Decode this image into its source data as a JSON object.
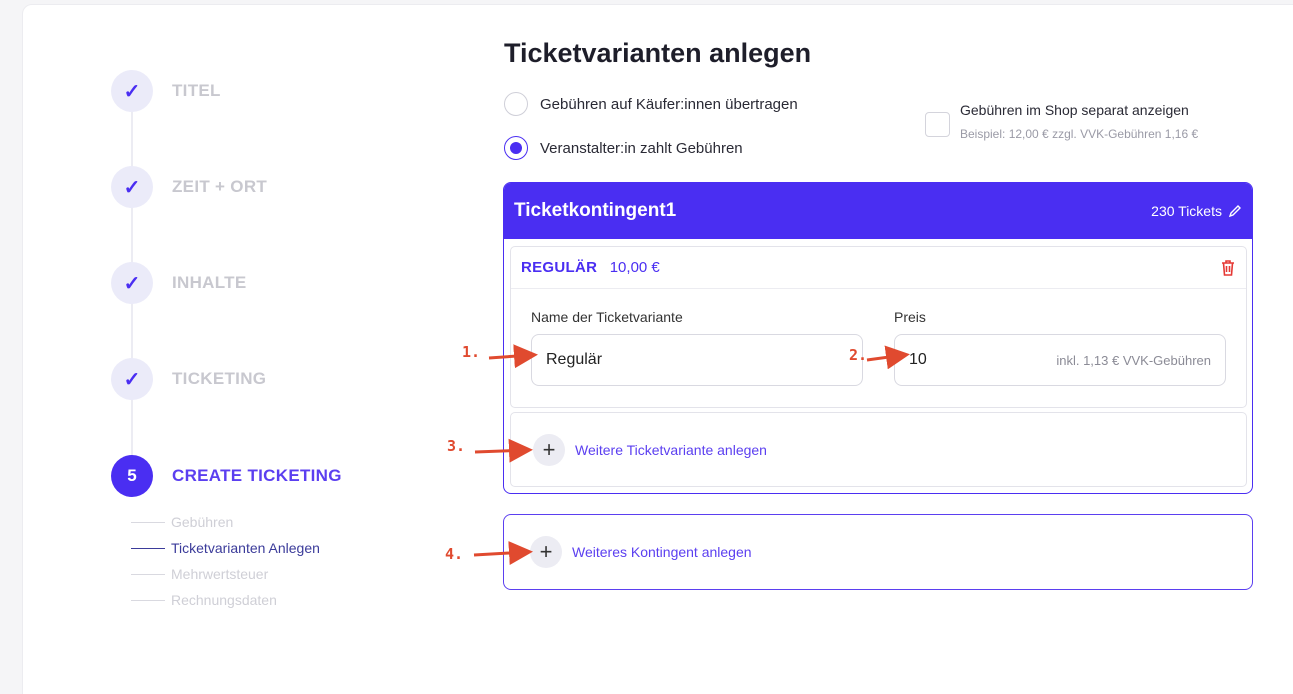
{
  "stepper": {
    "steps": [
      {
        "icon": "✓",
        "label": "TITEL"
      },
      {
        "icon": "✓",
        "label": "ZEIT + ORT"
      },
      {
        "icon": "✓",
        "label": "INHALTE"
      },
      {
        "icon": "✓",
        "label": "TICKETING"
      },
      {
        "icon": "5",
        "label": "CREATE TICKETING"
      }
    ],
    "substeps": [
      "Gebühren",
      "Ticketvarianten Anlegen",
      "Mehrwertsteuer",
      "Rechnungsdaten"
    ]
  },
  "main": {
    "title": "Ticketvarianten anlegen",
    "radio_buyer": "Gebühren auf Käufer:innen übertragen",
    "radio_organizer": "Veranstalter:in zahlt Gebühren",
    "checkbox_label": "Gebühren im Shop separat anzeigen",
    "checkbox_hint": "Beispiel: 12,00 € zzgl. VVK-Gebühren 1,16 €"
  },
  "kontingent": {
    "title": "Ticketkontingent1",
    "count": "230 Tickets",
    "variant": {
      "name": "REGULÄR",
      "price": "10,00 €",
      "name_label": "Name der Ticketvariante",
      "name_value": "Regulär",
      "price_label": "Preis",
      "price_value": "10",
      "price_suffix": "inkl. 1,13 € VVK-Gebühren"
    },
    "add_variant": "Weitere Ticketvariante anlegen"
  },
  "add_kontingent": "Weiteres Kontingent anlegen",
  "annotations": [
    "1.",
    "2.",
    "3.",
    "4."
  ],
  "colors": {
    "accent": "#4a2ef2",
    "annotation": "#e04a2f",
    "delete": "#e53935"
  }
}
